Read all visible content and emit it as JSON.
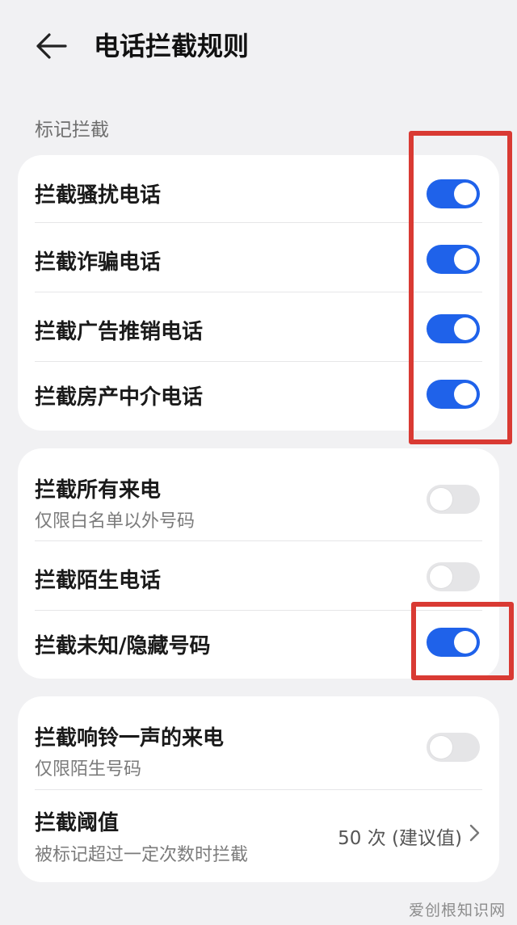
{
  "header": {
    "title": "电话拦截规则",
    "back_icon": "arrow-left-icon"
  },
  "section_marked": {
    "label": "标记拦截",
    "items": [
      {
        "title": "拦截骚扰电话",
        "enabled": true
      },
      {
        "title": "拦截诈骗电话",
        "enabled": true
      },
      {
        "title": "拦截广告推销电话",
        "enabled": true
      },
      {
        "title": "拦截房产中介电话",
        "enabled": true
      }
    ]
  },
  "section_general": {
    "items": [
      {
        "title": "拦截所有来电",
        "subtitle": "仅限白名单以外号码",
        "enabled": false
      },
      {
        "title": "拦截陌生电话",
        "enabled": false
      },
      {
        "title": "拦截未知/隐藏号码",
        "enabled": true
      }
    ]
  },
  "section_ring": {
    "items": [
      {
        "title": "拦截响铃一声的来电",
        "subtitle": "仅限陌生号码",
        "enabled": false
      },
      {
        "title": "拦截阈值",
        "subtitle": "被标记超过一定次数时拦截",
        "value": "50 次 (建议值)",
        "chevron_icon": "chevron-right-icon"
      }
    ]
  },
  "watermark": "爱创根知识网",
  "colors": {
    "accent": "#1f62ea",
    "toggle_off": "#e5e5e7",
    "annotation": "#d93a33",
    "background": "#f1f1f3"
  }
}
